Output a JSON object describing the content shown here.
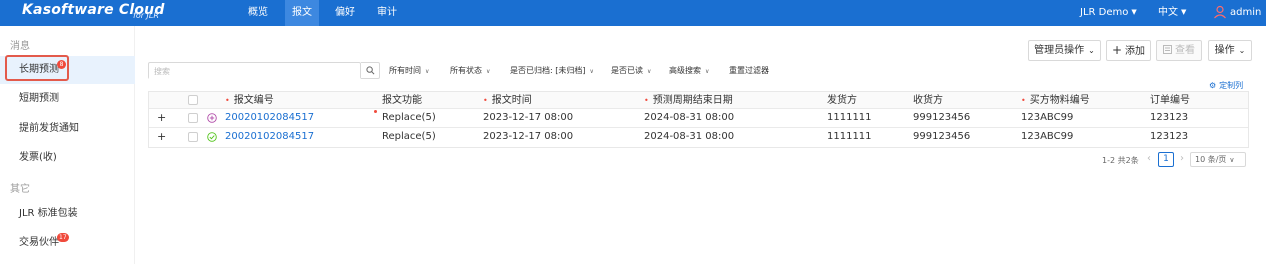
{
  "app": {
    "brand": "Kasoftware Cloud",
    "brand_sub": "for JLR",
    "nav": [
      "概览",
      "报文",
      "偏好",
      "审计"
    ],
    "active_nav": "报文",
    "account": "JLR Demo",
    "language": "中文",
    "user": "admin"
  },
  "sidebar": {
    "group_messages": "消息",
    "items_messages": [
      {
        "label": "长期预测",
        "badge": "8"
      },
      {
        "label": "短期预测"
      },
      {
        "label": "提前发货通知"
      },
      {
        "label": "发票(收)"
      }
    ],
    "group_other": "其它",
    "items_other": [
      {
        "label": "JLR 标准包装"
      },
      {
        "label": "交易伙伴",
        "badge": "17"
      }
    ]
  },
  "toolbar": {
    "admin_ops": "管理员操作",
    "add": "添加",
    "view": "查看",
    "actions": "操作"
  },
  "search": {
    "placeholder": "搜索"
  },
  "filters": {
    "time": "所有时间",
    "status": "所有状态",
    "archived": "是否已归档: [未归档]",
    "read": "是否已读",
    "advanced": "高级搜索",
    "reset": "重置过滤器"
  },
  "custom_columns": "定制列",
  "table": {
    "headers": [
      "报文编号",
      "报文功能",
      "报文时间",
      "预测周期结束日期",
      "发货方",
      "收货方",
      "买方物料编号",
      "订单编号"
    ],
    "rows": [
      {
        "id": "20020102084517",
        "func": "Replace(5)",
        "time": "2023-12-17 08:00",
        "end": "2024-08-31 08:00",
        "shipper": "1111111",
        "receiver": "999123456",
        "part": "123ABC99",
        "order": "123123",
        "status": "pending"
      },
      {
        "id": "20020102084517",
        "func": "Replace(5)",
        "time": "2023-12-17 08:00",
        "end": "2024-08-31 08:00",
        "shipper": "1111111",
        "receiver": "999123456",
        "part": "123ABC99",
        "order": "123123",
        "status": "ok"
      }
    ]
  },
  "pagination": {
    "total": "1-2 共2条",
    "current": "1",
    "page_size": "10 条/页"
  },
  "colors": {
    "primary": "#1a6fd1",
    "badge": "#f04a3c",
    "ok": "#52c41a",
    "pending": "#b04aa8"
  }
}
